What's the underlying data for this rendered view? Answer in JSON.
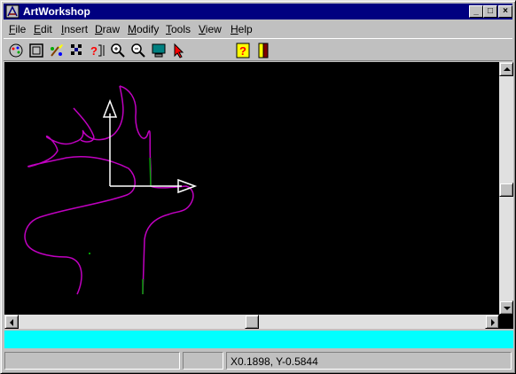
{
  "window": {
    "title": "ArtWorkshop"
  },
  "title_buttons": {
    "minimize": "_",
    "maximize": "□",
    "close": "×"
  },
  "menu": [
    {
      "label": "File",
      "key": "F",
      "rest": "ile"
    },
    {
      "label": "Edit",
      "key": "E",
      "rest": "dit"
    },
    {
      "label": "Insert",
      "key": "I",
      "rest": "nsert"
    },
    {
      "label": "Draw",
      "key": "D",
      "rest": "raw"
    },
    {
      "label": "Modify",
      "key": "M",
      "rest": "odify"
    },
    {
      "label": "Tools",
      "key": "T",
      "rest": "ools"
    },
    {
      "label": "View",
      "key": "V",
      "rest": "iew"
    },
    {
      "label": "Help",
      "key": "H",
      "rest": "elp"
    }
  ],
  "toolbar_icons": [
    "palette-icon",
    "frame-icon",
    "paint-brush-icon",
    "pattern-icon",
    "query-icon",
    "zoom-in-icon",
    "zoom-out-icon",
    "monitor-icon",
    "pointer-icon",
    "help-icon",
    "exit-icon"
  ],
  "colors": {
    "canvas": "#000000",
    "curve": "#c000c0",
    "green": "#00a000",
    "axes": "#ffffff",
    "cyan_bar": "#00ffff",
    "title_bar": "#000080"
  },
  "status": {
    "pane1": "",
    "pane2": "",
    "coords": "X0.1898, Y-0.5844"
  }
}
